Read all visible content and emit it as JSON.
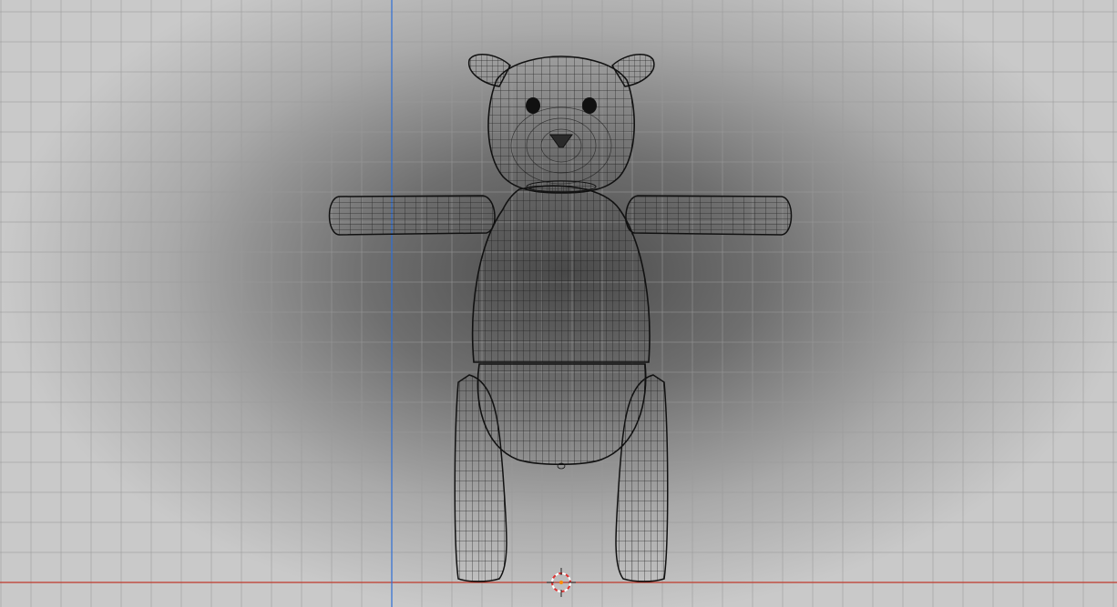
{
  "viewport": {
    "view": "front-orthographic",
    "shading": "wireframe",
    "grid_visible": true,
    "colors": {
      "background_center": "#4a4a4a",
      "background_edge": "#c9c9c9",
      "grid_line": "#9a9a9a",
      "x_axis": "#c0392b",
      "z_axis": "#2e6fd6",
      "wire": "#1a1a1a",
      "eye": "#111111"
    },
    "object": {
      "name_icon": "teddy-bear-mesh",
      "parts": [
        "ear-left",
        "ear-right",
        "head",
        "eye-left",
        "eye-right",
        "nose",
        "neck",
        "arm-left",
        "arm-right",
        "torso",
        "belly",
        "leg-left",
        "leg-right"
      ]
    },
    "cursor": {
      "icon": "3d-cursor-icon",
      "ring_color_a": "#e03030",
      "ring_color_b": "#ffffff"
    }
  }
}
